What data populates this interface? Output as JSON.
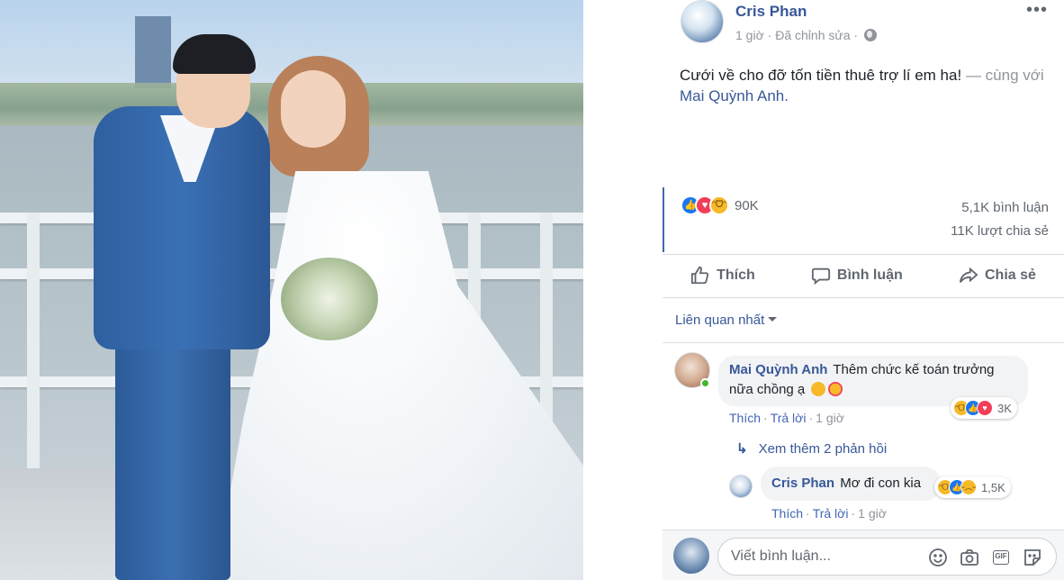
{
  "post": {
    "author": "Cris Phan",
    "time": "1 giờ",
    "edited": "Đã chỉnh sửa",
    "meta_separator": "·",
    "more_icon": "•••",
    "text": "Cưới về cho đỡ tốn tiền thuê trợ lí em ha!",
    "with_text": "— cùng với",
    "tagged": "Mai Quỳnh Anh.",
    "reactions": [
      "like-icon",
      "love-icon",
      "haha-icon"
    ],
    "reaction_count": "90K",
    "comment_count": "5,1K bình luận",
    "share_count": "11K lượt chia sẻ"
  },
  "actions": {
    "like": "Thích",
    "comment": "Bình luận",
    "share": "Chia sẻ"
  },
  "sort_label": "Liên quan nhất",
  "comments": [
    {
      "name": "Mai Quỳnh Anh",
      "text_line1": "Thêm chức kế toán trưởng",
      "text_line2": "nữa chồng ạ",
      "emojis": [
        "kissing-heart-emoji",
        "smiling-hearts-emoji"
      ],
      "like_label": "Thích",
      "reply_label": "Trả lời",
      "time": "1 giờ",
      "reactions": [
        "haha-icon",
        "like-icon",
        "love-icon"
      ],
      "reaction_count": "3K",
      "online": true
    }
  ],
  "view_replies": "Xem thêm 2 phản hồi",
  "reply": {
    "name": "Cris Phan",
    "text": "Mơ đi con kia",
    "like_label": "Thích",
    "reply_label": "Trả lời",
    "time": "1 giờ",
    "reactions": [
      "haha-icon",
      "like-icon",
      "sad-icon"
    ],
    "reaction_count": "1,5K"
  },
  "composer": {
    "placeholder": "Viết bình luận...",
    "tools": [
      "emoji-icon",
      "camera-icon",
      "gif-icon",
      "sticker-icon"
    ],
    "gif_label": "GIF"
  },
  "colors": {
    "link": "#385898",
    "like_blue": "#1877f2",
    "love_red": "#f33e58",
    "haha_yellow": "#f7b928",
    "secondary_text": "#90949c"
  }
}
